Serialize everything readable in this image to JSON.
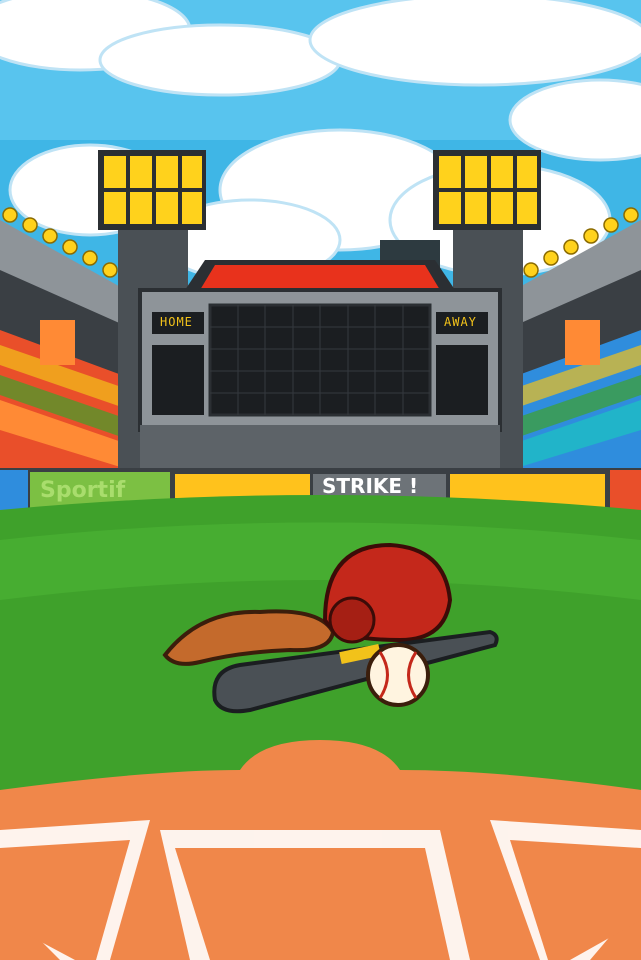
{
  "scoreboard": {
    "home_label": "HOME",
    "away_label": "AWAY"
  },
  "banners": {
    "left": "Sportif",
    "center": "STRIKE !"
  },
  "colors": {
    "sky": "#3fb6e6",
    "grass": "#3fa12b",
    "dirt": "#f0874a",
    "scoreboard_accent": "#e8321c",
    "light_bulbs": "#ffd21c"
  },
  "icons": {
    "helmet": "batting-helmet-icon",
    "glove": "baseball-glove-icon",
    "bat": "baseball-bat-icon",
    "ball": "baseball-icon"
  }
}
